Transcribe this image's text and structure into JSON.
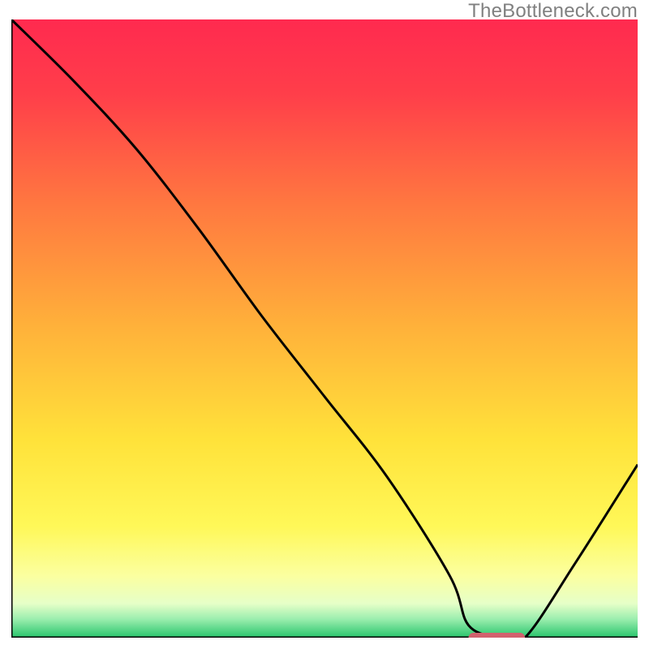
{
  "watermark": "TheBottleneck.com",
  "chart_data": {
    "type": "line",
    "title": "",
    "xlabel": "",
    "ylabel": "",
    "xlim": [
      0,
      100
    ],
    "ylim": [
      0,
      100
    ],
    "background_gradient": {
      "stops": [
        {
          "offset": 0.0,
          "color": "#ff2a4f"
        },
        {
          "offset": 0.12,
          "color": "#ff3e4a"
        },
        {
          "offset": 0.3,
          "color": "#ff7840"
        },
        {
          "offset": 0.5,
          "color": "#ffb23a"
        },
        {
          "offset": 0.68,
          "color": "#ffe23a"
        },
        {
          "offset": 0.82,
          "color": "#fff858"
        },
        {
          "offset": 0.9,
          "color": "#fbffa0"
        },
        {
          "offset": 0.945,
          "color": "#e6ffc8"
        },
        {
          "offset": 0.97,
          "color": "#9beeae"
        },
        {
          "offset": 1.0,
          "color": "#27c46b"
        }
      ]
    },
    "series": [
      {
        "name": "bottleneck-curve",
        "x": [
          0,
          10,
          20,
          30,
          40,
          50,
          60,
          70,
          73,
          78,
          82,
          90,
          100
        ],
        "y": [
          100,
          90,
          79,
          66,
          52,
          39,
          26,
          10,
          2,
          0,
          0,
          12,
          28
        ]
      }
    ],
    "marker": {
      "name": "optimal-range",
      "x_start": 73,
      "x_end": 82,
      "y": 0,
      "color": "#d2616e"
    },
    "annotations": []
  }
}
